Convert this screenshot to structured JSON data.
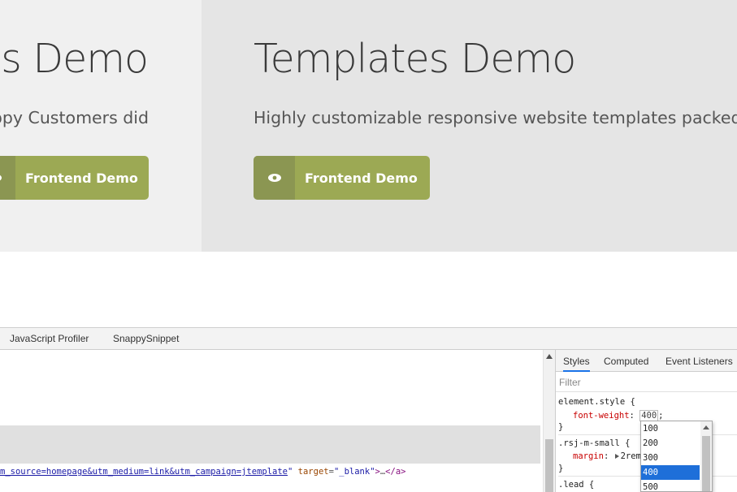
{
  "site": {
    "left_panel": {
      "title": "ns Demo",
      "lead": "appy Customers did",
      "button_label": "Frontend Demo"
    },
    "right_panel": {
      "title": "Templates Demo",
      "lead": "Highly customizable responsive website templates packed wi",
      "button_label": "Frontend Demo"
    },
    "colors": {
      "left_panel_bg": "#f0f0f0",
      "right_panel_bg": "#e5e5e5",
      "button_bg": "#9ca954",
      "button_icon_bg": "#8b9652"
    },
    "button_icon": "eye-icon"
  },
  "devtools": {
    "tabs": [
      "JavaScript Profiler",
      "SnappySnippet"
    ],
    "elements": {
      "link_text": "m_source=homepage&utm_medium=link&utm_campaign=jtemplate",
      "after_link": "\"",
      "attr_name": " target",
      "eq": "=",
      "attr_value": "\"_blank\"",
      "tag_close": ">",
      "ellipsis": "…",
      "end_tag": "</a>"
    },
    "styles": {
      "tabs": [
        "Styles",
        "Computed",
        "Event Listeners"
      ],
      "active_tab": "Styles",
      "filter_placeholder": "Filter",
      "element_style_selector": "element.style {",
      "font_weight_prop": "font-weight",
      "font_weight_value": "400",
      "rule_close": "}",
      "rsj_selector": ".rsj-m-small {",
      "margin_prop": "margin",
      "margin_value": "2rem",
      "lead_selector": ".lead {"
    },
    "autocomplete": {
      "options": [
        "100",
        "200",
        "300",
        "400",
        "500"
      ],
      "selected": "400"
    }
  }
}
